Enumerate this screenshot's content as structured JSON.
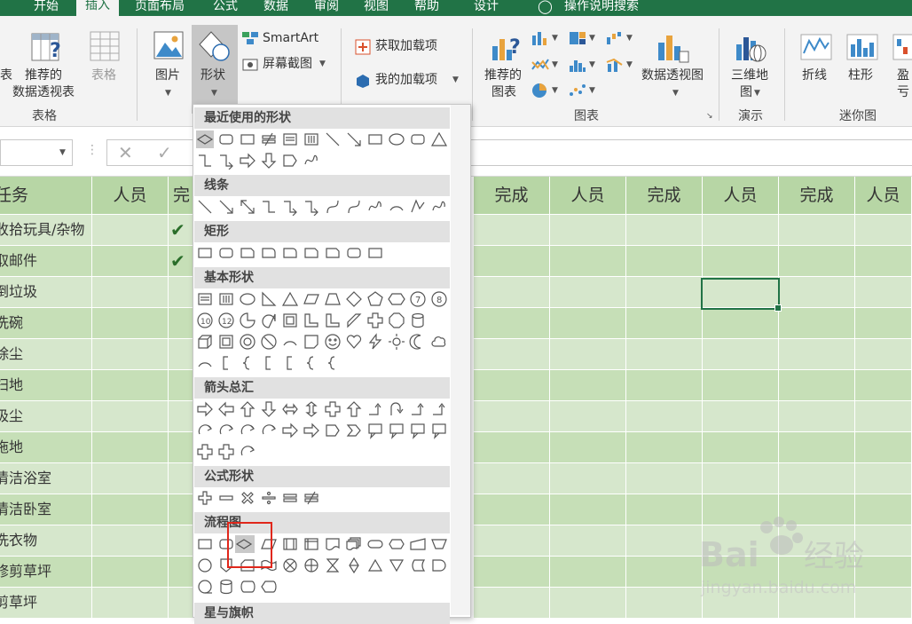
{
  "tabs": [
    {
      "label": "开始",
      "active": false
    },
    {
      "label": "插入",
      "active": true
    },
    {
      "label": "页面布局",
      "active": false
    },
    {
      "label": "公式",
      "active": false
    },
    {
      "label": "数据",
      "active": false
    },
    {
      "label": "审阅",
      "active": false
    },
    {
      "label": "视图",
      "active": false
    },
    {
      "label": "帮助",
      "active": false
    },
    {
      "label": "设计",
      "active": false
    }
  ],
  "tell_me": "操作说明搜索",
  "ribbon": {
    "table_group": {
      "partial_label": "表",
      "pivot_line1": "推荐的",
      "pivot_line2": "数据透视表",
      "table": "表格",
      "group_label": "表格"
    },
    "illustrations": {
      "picture": "图片",
      "shapes": "形状",
      "smartart": "SmartArt",
      "screenshot": "屏幕截图"
    },
    "addins": {
      "get": "获取加载项",
      "mine": "我的加载项"
    },
    "charts": {
      "recommended_line1": "推荐的",
      "recommended_line2": "图表",
      "pivot_chart": "数据透视图",
      "group_label": "图表"
    },
    "tours": {
      "map_line1": "三维地",
      "map_line2": "图",
      "group_label": "演示"
    },
    "sparklines": {
      "line": "折线",
      "column": "柱形",
      "winloss": "盈亏",
      "group_label": "迷你图"
    }
  },
  "formula_bar": {
    "cancel": "✕",
    "enter": "✓"
  },
  "sheet": {
    "headers": [
      "任务",
      "人员",
      "完",
      "完成",
      "人员",
      "完成",
      "人员",
      "完成",
      "人员"
    ],
    "rows": [
      {
        "task": "收拾玩具/杂物",
        "checked": true
      },
      {
        "task": "取邮件",
        "checked": true
      },
      {
        "task": "倒垃圾",
        "checked": false
      },
      {
        "task": "洗碗",
        "checked": false
      },
      {
        "task": "除尘",
        "checked": false
      },
      {
        "task": "扫地",
        "checked": false
      },
      {
        "task": "吸尘",
        "checked": false
      },
      {
        "task": "拖地",
        "checked": false
      },
      {
        "task": "清洁浴室",
        "checked": false
      },
      {
        "task": "清洁卧室",
        "checked": false
      },
      {
        "task": "洗衣物",
        "checked": false
      },
      {
        "task": "修剪草坪",
        "checked": false
      },
      {
        "task": "剪草坪",
        "checked": false
      }
    ]
  },
  "shapes_menu": {
    "sections": [
      "最近使用的形状",
      "线条",
      "矩形",
      "基本形状",
      "箭头总汇",
      "公式形状",
      "流程图",
      "星与旗帜"
    ]
  },
  "colors": {
    "accent": "#217346",
    "header_fill": "#b7d6a5",
    "row_fill_a": "#d6e7cc",
    "row_fill_b": "#c6dfb7",
    "highlight": "#e0271b"
  },
  "watermark": {
    "text": "Bai 经验",
    "url": "jingyan.baidu.com"
  }
}
